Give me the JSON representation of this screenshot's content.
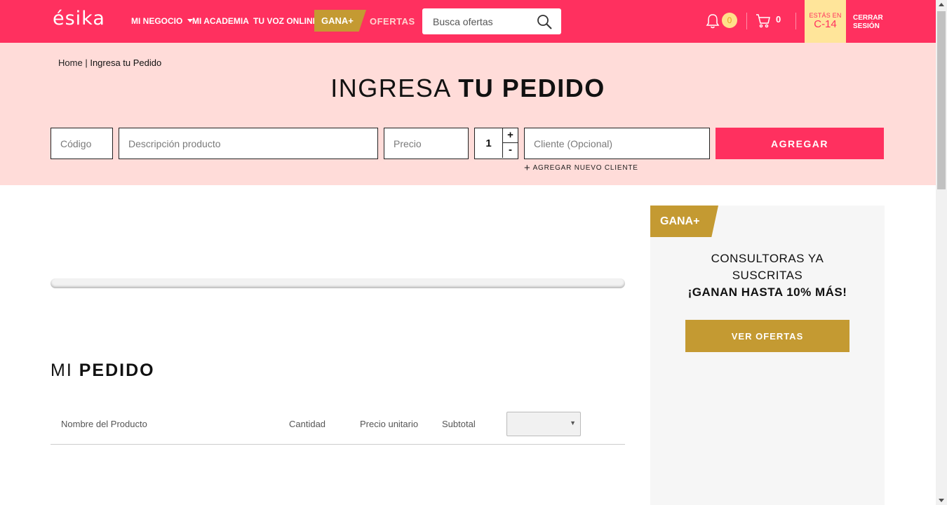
{
  "header": {
    "logo": "ésika",
    "nav": {
      "mi_negocio": "MI NEGOCIO",
      "mi_academia": "MI ACADEMIA",
      "tu_voz_online": "TU VOZ ONLINE",
      "gana_tag": "GANA+",
      "ofertas": "OFERTAS"
    },
    "search": {
      "placeholder": "Busca ofertas",
      "icon": "search-icon"
    },
    "notifications": {
      "count": "0",
      "icon": "bell-icon"
    },
    "cart": {
      "count": "0",
      "icon": "cart-icon"
    },
    "campaign": {
      "label": "ESTÁS EN",
      "value": "C-14"
    },
    "logout": {
      "line1": "CERRAR",
      "line2": "SESIÓN"
    }
  },
  "breadcrumb": {
    "home": "Home",
    "separator": "|",
    "current": "Ingresa tu Pedido"
  },
  "title": {
    "light": "INGRESA",
    "bold": "TU PEDIDO"
  },
  "order_form": {
    "code_placeholder": "Código",
    "description_placeholder": "Descripción producto",
    "price_placeholder": "Precio",
    "quantity": "1",
    "plus": "+",
    "minus": "-",
    "client_placeholder": "Cliente (Opcional)",
    "add_button": "AGREGAR",
    "add_client_link": "AGREGAR NUEVO CLIENTE"
  },
  "progress": {
    "value_percent": 0
  },
  "my_order": {
    "title_light": "MI",
    "title_bold": "PEDIDO",
    "columns": [
      "Nombre del Producto",
      "Cantidad",
      "Precio unitario",
      "Subtotal"
    ],
    "select_value": ""
  },
  "sidebar": {
    "tag": "GANA+",
    "line1": "CONSULTORAS YA",
    "line2": "SUSCRITAS",
    "line3": "¡GANAN HASTA 10% MÁS!",
    "button": "VER OFERTAS"
  },
  "colors": {
    "brand_pink": "#ff305f",
    "hero_bg": "#ffdcd9",
    "gold": "#c49a32",
    "campaign_bg": "#ffe59a"
  }
}
